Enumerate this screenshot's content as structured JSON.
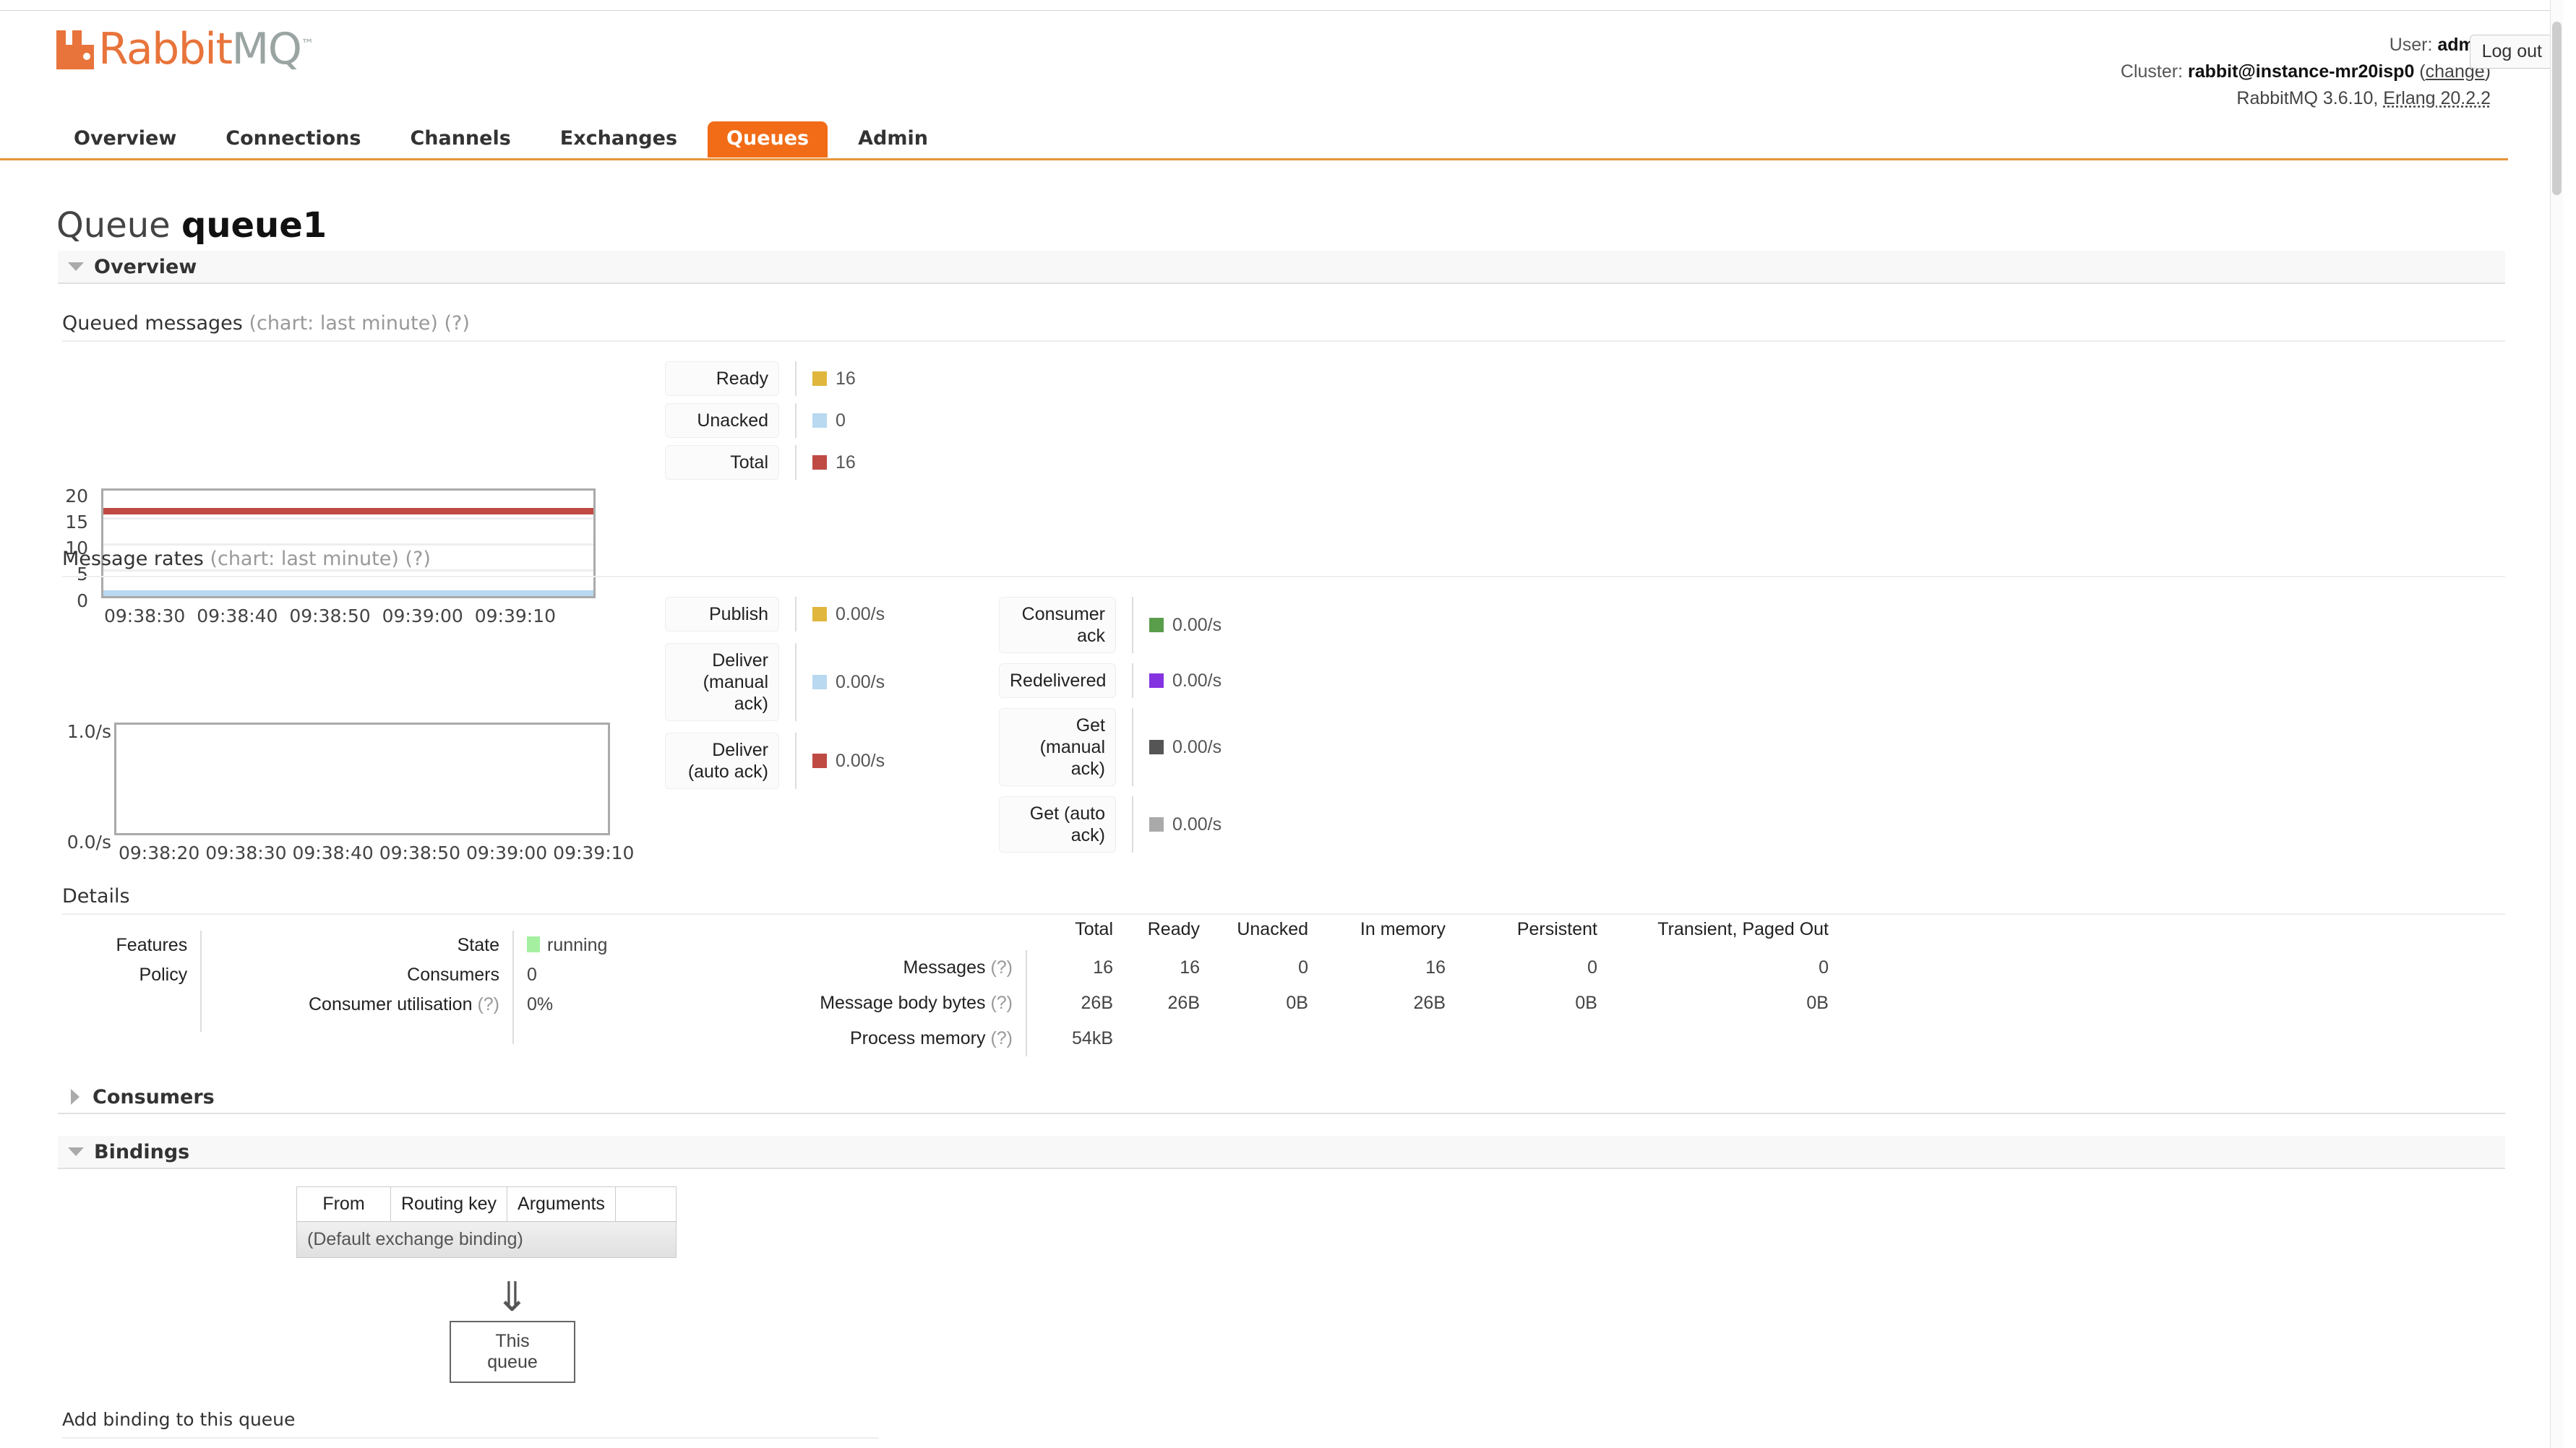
{
  "header": {
    "logo_rab": "Rabbit",
    "logo_mq": "MQ",
    "logo_tm": "™",
    "user_label": "User:",
    "user_name": "admin",
    "cluster_label": "Cluster:",
    "cluster_name": "rabbit@instance-mr20isp0",
    "cluster_change": "change",
    "version_line": "RabbitMQ 3.6.10, ",
    "erlang_version": "Erlang 20.2.2",
    "logout_label": "Log out",
    "accent_color": "#f26c17"
  },
  "nav": {
    "tabs": [
      {
        "label": "Overview",
        "active": false
      },
      {
        "label": "Connections",
        "active": false
      },
      {
        "label": "Channels",
        "active": false
      },
      {
        "label": "Exchanges",
        "active": false
      },
      {
        "label": "Queues",
        "active": true
      },
      {
        "label": "Admin",
        "active": false
      }
    ]
  },
  "page": {
    "title_prefix": "Queue",
    "title_name": "queue1"
  },
  "sections": {
    "overview": {
      "label": "Overview",
      "expanded": true
    },
    "consumers": {
      "label": "Consumers",
      "expanded": false
    },
    "bindings": {
      "label": "Bindings",
      "expanded": true
    }
  },
  "queued_messages": {
    "title": "Queued messages",
    "subtitle": "(chart: last minute)",
    "help": "(?)",
    "legend": [
      {
        "label": "Ready",
        "value": "16",
        "color": "#e0b63c"
      },
      {
        "label": "Unacked",
        "value": "0",
        "color": "#b8d9f0"
      },
      {
        "label": "Total",
        "value": "16",
        "color": "#bf4a43"
      }
    ]
  },
  "message_rates": {
    "title": "Message rates",
    "subtitle": "(chart: last minute)",
    "help": "(?)",
    "legend_left": [
      {
        "label": "Publish",
        "value": "0.00/s",
        "color": "#e0b63c"
      },
      {
        "label": "Deliver (manual ack)",
        "value": "0.00/s",
        "color": "#b8d9f0"
      },
      {
        "label": "Deliver (auto ack)",
        "value": "0.00/s",
        "color": "#bf4a43"
      }
    ],
    "legend_right": [
      {
        "label": "Consumer ack",
        "value": "0.00/s",
        "color": "#5a9e4b"
      },
      {
        "label": "Redelivered",
        "value": "0.00/s",
        "color": "#8433e0"
      },
      {
        "label": "Get (manual ack)",
        "value": "0.00/s",
        "color": "#555555"
      },
      {
        "label": "Get (auto ack)",
        "value": "0.00/s",
        "color": "#aaaaaa"
      }
    ]
  },
  "details": {
    "title": "Details",
    "left_rows": [
      {
        "label": "Features",
        "value": ""
      },
      {
        "label": "Policy",
        "value": ""
      }
    ],
    "mid_rows": [
      {
        "label": "State",
        "help": "",
        "value": "running",
        "swatch": "#a4f0a0"
      },
      {
        "label": "Consumers",
        "help": "",
        "value": "0",
        "swatch": ""
      },
      {
        "label": "Consumer utilisation",
        "help": "(?)",
        "value": "0%",
        "swatch": ""
      }
    ],
    "stats": {
      "columns": [
        "Total",
        "Ready",
        "Unacked",
        "In memory",
        "Persistent",
        "Transient, Paged Out"
      ],
      "rows": [
        {
          "label": "Messages",
          "help": "(?)",
          "values": [
            "16",
            "16",
            "0",
            "16",
            "0",
            "0"
          ]
        },
        {
          "label": "Message body bytes",
          "help": "(?)",
          "values": [
            "26B",
            "26B",
            "0B",
            "26B",
            "0B",
            "0B"
          ]
        },
        {
          "label": "Process memory",
          "help": "(?)",
          "values": [
            "54kB",
            "",
            "",
            "",
            "",
            ""
          ]
        }
      ]
    }
  },
  "bindings": {
    "columns": [
      "From",
      "Routing key",
      "Arguments",
      ""
    ],
    "rows": [
      {
        "text": "(Default exchange binding)"
      }
    ],
    "arrow": "⇓",
    "this_queue": "This queue",
    "add_binding_label": "Add binding to this queue"
  },
  "chart_data": [
    {
      "type": "line",
      "title": "Queued messages",
      "subtitle": "chart: last minute",
      "xlabel": "",
      "ylabel": "",
      "ylim": [
        0,
        20
      ],
      "yticks": [
        0,
        5,
        10,
        15,
        20
      ],
      "x": [
        "09:38:30",
        "09:38:40",
        "09:38:50",
        "09:39:00",
        "09:39:10"
      ],
      "grid": true,
      "legend_position": "right",
      "series": [
        {
          "name": "Ready",
          "color": "#e0b63c",
          "values": [
            16,
            16,
            16,
            16,
            16
          ],
          "current": 16
        },
        {
          "name": "Unacked",
          "color": "#b8d9f0",
          "values": [
            0,
            0,
            0,
            0,
            0
          ],
          "current": 0
        },
        {
          "name": "Total",
          "color": "#bf4a43",
          "values": [
            16,
            16,
            16,
            16,
            16
          ],
          "current": 16
        }
      ]
    },
    {
      "type": "line",
      "title": "Message rates",
      "subtitle": "chart: last minute",
      "xlabel": "",
      "ylabel": "",
      "ylim": [
        0,
        1
      ],
      "yticks": [
        "0.0/s",
        "1.0/s"
      ],
      "x": [
        "09:38:20",
        "09:38:30",
        "09:38:40",
        "09:38:50",
        "09:39:00",
        "09:39:10"
      ],
      "grid": false,
      "legend_position": "right",
      "series": [
        {
          "name": "Publish",
          "color": "#e0b63c",
          "values": [
            0,
            0,
            0,
            0,
            0,
            0
          ],
          "current": "0.00/s"
        },
        {
          "name": "Deliver (manual ack)",
          "color": "#b8d9f0",
          "values": [
            0,
            0,
            0,
            0,
            0,
            0
          ],
          "current": "0.00/s"
        },
        {
          "name": "Deliver (auto ack)",
          "color": "#bf4a43",
          "values": [
            0,
            0,
            0,
            0,
            0,
            0
          ],
          "current": "0.00/s"
        },
        {
          "name": "Consumer ack",
          "color": "#5a9e4b",
          "values": [
            0,
            0,
            0,
            0,
            0,
            0
          ],
          "current": "0.00/s"
        },
        {
          "name": "Redelivered",
          "color": "#8433e0",
          "values": [
            0,
            0,
            0,
            0,
            0,
            0
          ],
          "current": "0.00/s"
        },
        {
          "name": "Get (manual ack)",
          "color": "#555555",
          "values": [
            0,
            0,
            0,
            0,
            0,
            0
          ],
          "current": "0.00/s"
        },
        {
          "name": "Get (auto ack)",
          "color": "#aaaaaa",
          "values": [
            0,
            0,
            0,
            0,
            0,
            0
          ],
          "current": "0.00/s"
        }
      ]
    }
  ]
}
